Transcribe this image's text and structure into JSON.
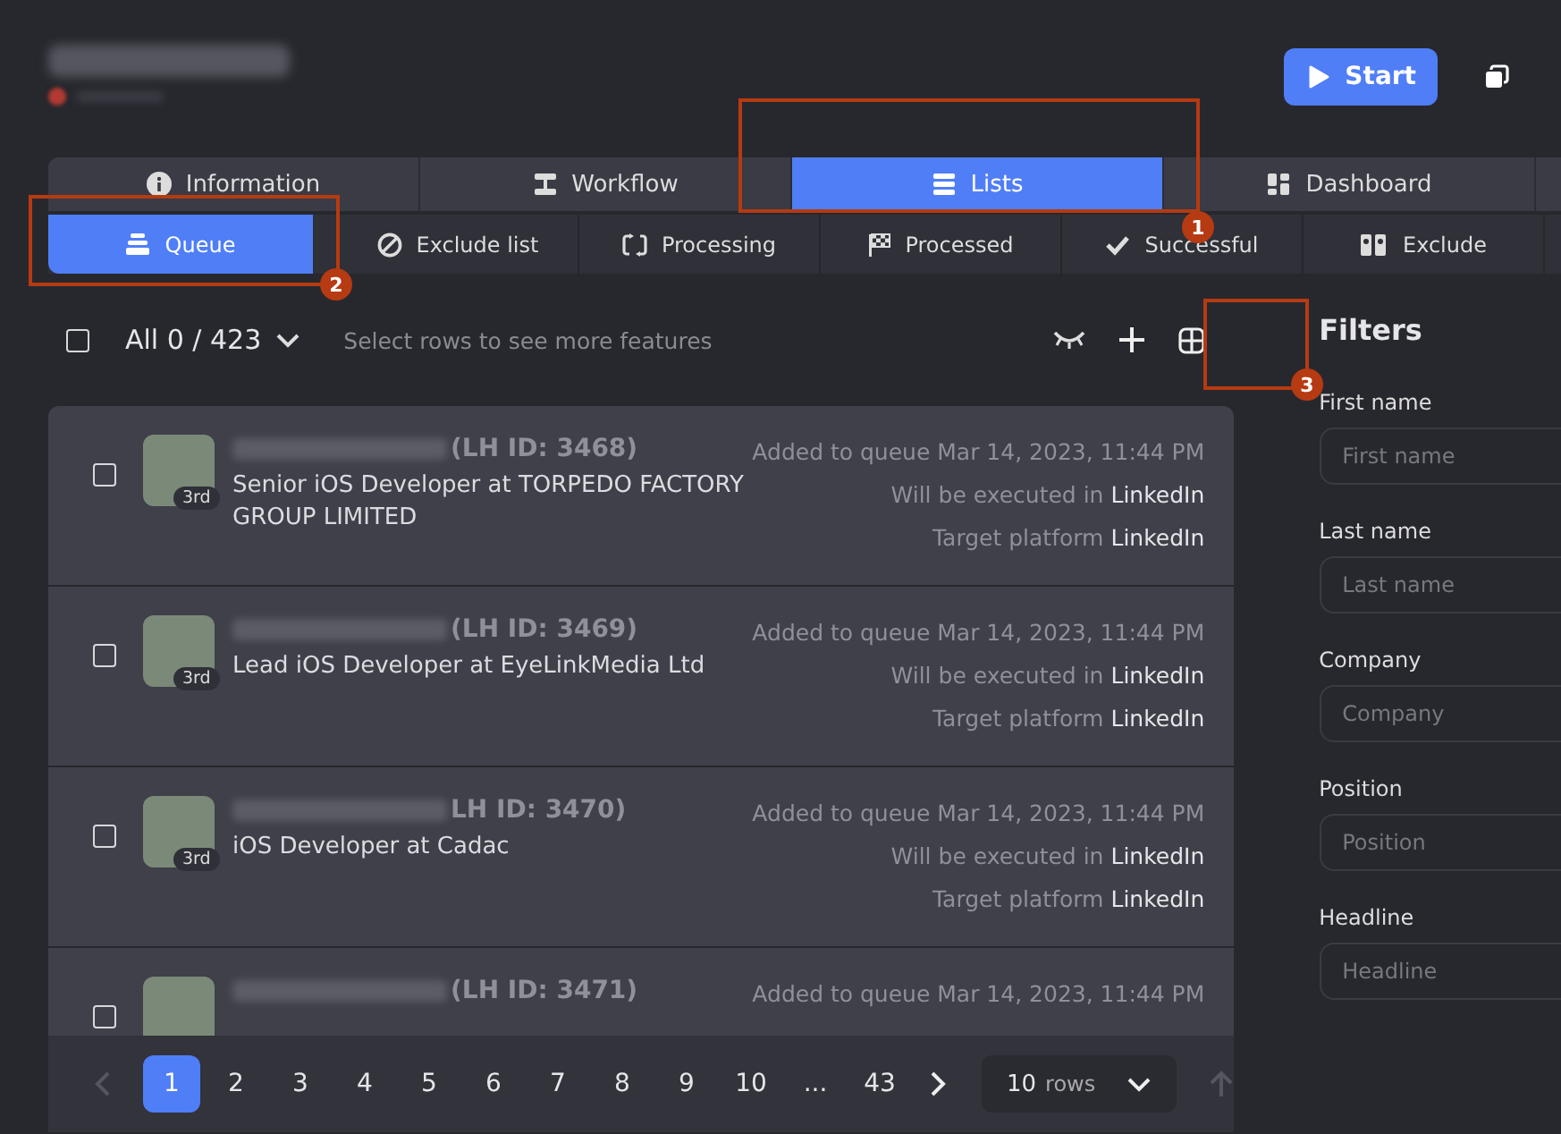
{
  "header": {
    "start_button": "Start"
  },
  "main_tabs": [
    {
      "label": "Information",
      "selected": false
    },
    {
      "label": "Workflow",
      "selected": false
    },
    {
      "label": "Lists",
      "selected": true
    },
    {
      "label": "Dashboard",
      "selected": false
    }
  ],
  "sub_tabs": [
    {
      "label": "Queue",
      "selected": true
    },
    {
      "label": "Exclude list",
      "selected": false
    },
    {
      "label": "Processing",
      "selected": false
    },
    {
      "label": "Processed",
      "selected": false
    },
    {
      "label": "Successful",
      "selected": false
    },
    {
      "label": "Exclude",
      "selected": false
    }
  ],
  "toolbar": {
    "select_all_checked": false,
    "count": "All 0 / 423",
    "hint": "Select rows to see more features"
  },
  "rows": [
    {
      "checked": false,
      "degree": "3rd",
      "lh_id": "(LH ID: 3468)",
      "headline": "Senior iOS Developer at TORPEDO FACTORY GROUP LIMITED",
      "added": "Added to queue Mar 14, 2023, 11:44 PM",
      "executed_label": "Will be executed in",
      "executed_value": "LinkedIn",
      "target_label": "Target platform",
      "target_value": "LinkedIn"
    },
    {
      "checked": false,
      "degree": "3rd",
      "lh_id": "(LH ID: 3469)",
      "headline": "Lead iOS Developer at EyeLinkMedia Ltd",
      "added": "Added to queue Mar 14, 2023, 11:44 PM",
      "executed_label": "Will be executed in",
      "executed_value": "LinkedIn",
      "target_label": "Target platform",
      "target_value": "LinkedIn"
    },
    {
      "checked": false,
      "degree": "3rd",
      "lh_id": "LH ID: 3470)",
      "headline": "iOS Developer at Cadac",
      "added": "Added to queue Mar 14, 2023, 11:44 PM",
      "executed_label": "Will be executed in",
      "executed_value": "LinkedIn",
      "target_label": "Target platform",
      "target_value": "LinkedIn"
    },
    {
      "checked": false,
      "lh_id": "(LH ID: 3471)",
      "added": "Added to queue Mar 14, 2023, 11:44 PM"
    }
  ],
  "pagination": {
    "pages": [
      {
        "label": "1",
        "selected": true
      },
      {
        "label": "2",
        "selected": false
      },
      {
        "label": "3",
        "selected": false
      },
      {
        "label": "4",
        "selected": false
      },
      {
        "label": "5",
        "selected": false
      },
      {
        "label": "6",
        "selected": false
      },
      {
        "label": "7",
        "selected": false
      },
      {
        "label": "8",
        "selected": false
      },
      {
        "label": "9",
        "selected": false
      },
      {
        "label": "10",
        "selected": false
      },
      {
        "label": "...",
        "selected": false
      },
      {
        "label": "43",
        "selected": false
      }
    ],
    "rows_count": "10",
    "rows_label": "rows"
  },
  "filters": {
    "title": "Filters",
    "fields": [
      {
        "label": "First name",
        "placeholder": "First name"
      },
      {
        "label": "Last name",
        "placeholder": "Last name"
      },
      {
        "label": "Company",
        "placeholder": "Company"
      },
      {
        "label": "Position",
        "placeholder": "Position"
      },
      {
        "label": "Headline",
        "placeholder": "Headline"
      }
    ]
  },
  "callouts": [
    "1",
    "2",
    "3"
  ]
}
